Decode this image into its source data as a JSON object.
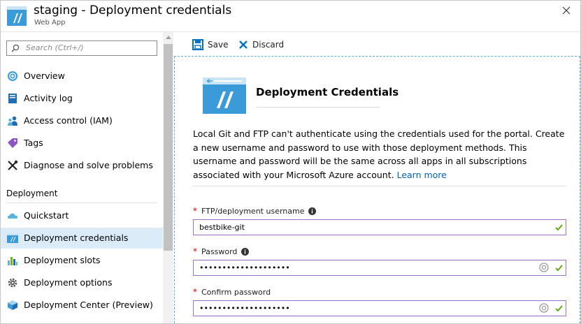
{
  "header": {
    "title": "staging - Deployment credentials",
    "subtitle": "Web App"
  },
  "sidebar": {
    "search_placeholder": "Search (Ctrl+/)",
    "items": [
      {
        "label": "Overview",
        "icon": "globe-icon"
      },
      {
        "label": "Activity log",
        "icon": "activity-log-icon"
      },
      {
        "label": "Access control (IAM)",
        "icon": "people-icon"
      },
      {
        "label": "Tags",
        "icon": "tag-icon"
      },
      {
        "label": "Diagnose and solve problems",
        "icon": "wrench-icon"
      }
    ],
    "section": "Deployment",
    "deployment_items": [
      {
        "label": "Quickstart",
        "icon": "cloud-icon"
      },
      {
        "label": "Deployment credentials",
        "icon": "webapp-icon",
        "active": true
      },
      {
        "label": "Deployment slots",
        "icon": "slots-icon"
      },
      {
        "label": "Deployment options",
        "icon": "gear-icon"
      },
      {
        "label": "Deployment Center (Preview)",
        "icon": "cube-icon"
      }
    ]
  },
  "toolbar": {
    "save_label": "Save",
    "discard_label": "Discard"
  },
  "content": {
    "title": "Deployment Credentials",
    "description": "Local Git and FTP can't authenticate using the credentials used for the portal. Create a new username and password to use with those deployment methods. This username and password will be the same across all apps in all subscriptions associated with your Microsoft Azure account. ",
    "learn_more": "Learn more",
    "fields": {
      "username": {
        "label": "FTP/deployment username",
        "value": "bestbike-git"
      },
      "password": {
        "label": "Password",
        "value": "••••••••••••••••••••"
      },
      "confirm": {
        "label": "Confirm password",
        "value": "••••••••••••••••••••"
      }
    }
  },
  "colors": {
    "accent": "#0072c6",
    "active_bg": "#dcebf8",
    "valid_border": "#9c6fc5",
    "check": "#57a300",
    "required": "#cc0000"
  }
}
